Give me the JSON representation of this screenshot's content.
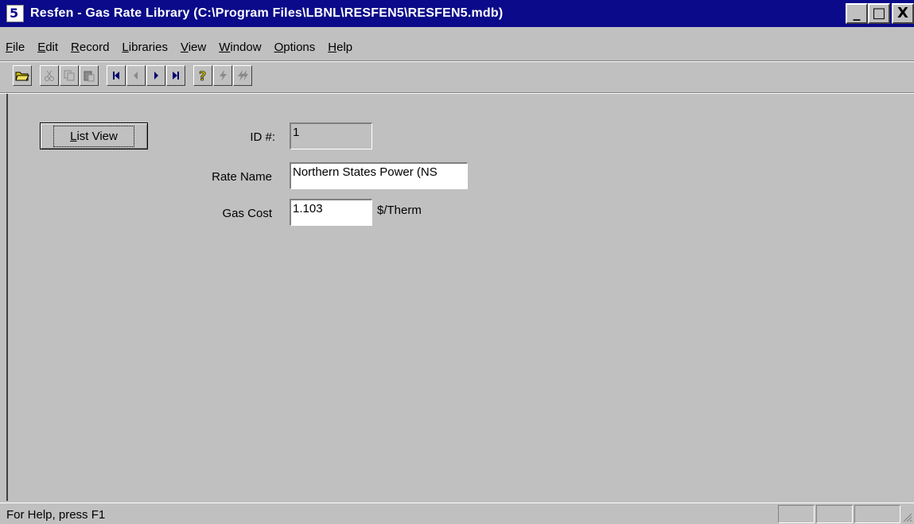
{
  "window": {
    "title": "Resfen - Gas Rate Library (C:\\Program Files\\LBNL\\RESFEN5\\RESFEN5.mdb)",
    "minimize": "_",
    "maximize": "□",
    "close": "X"
  },
  "menu": {
    "items": [
      {
        "first": "F",
        "rest": "ile"
      },
      {
        "first": "E",
        "rest": "dit"
      },
      {
        "first": "R",
        "rest": "ecord"
      },
      {
        "first": "L",
        "rest": "ibraries"
      },
      {
        "first": "V",
        "rest": "iew"
      },
      {
        "first": "W",
        "rest": "indow"
      },
      {
        "first": "O",
        "rest": "ptions"
      },
      {
        "first": "H",
        "rest": "elp"
      }
    ]
  },
  "toolbar": {
    "icons": [
      "open-folder-icon",
      "cut-icon",
      "copy-icon",
      "paste-icon",
      "first-record-icon",
      "previous-record-icon",
      "next-record-icon",
      "last-record-icon",
      "help-icon",
      "calculate-icon",
      "calculate-all-icon"
    ]
  },
  "form": {
    "list_view_first": "L",
    "list_view_rest": "ist View",
    "id_label": "ID #:",
    "id_value": "1",
    "rate_name_label": "Rate Name",
    "rate_name_value": "Northern States Power (NS",
    "gas_cost_label": "Gas Cost",
    "gas_cost_value": "1.103",
    "gas_cost_unit": "$/Therm"
  },
  "status": {
    "text": "For Help, press F1"
  }
}
